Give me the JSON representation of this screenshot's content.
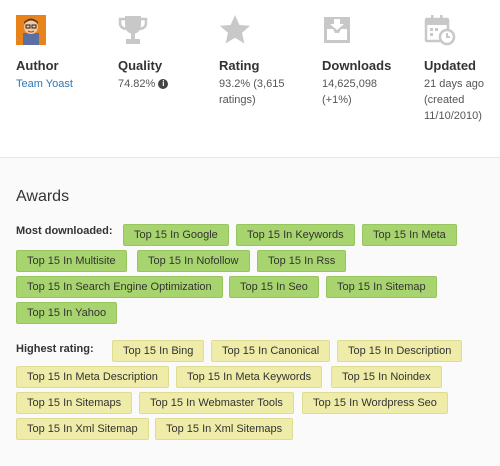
{
  "stats": {
    "author": {
      "label": "Author",
      "value": "Team Yoast"
    },
    "quality": {
      "label": "Quality",
      "value": "74.82%"
    },
    "rating": {
      "label": "Rating",
      "value_line1": "93.2% (3,615",
      "value_line2": "ratings)"
    },
    "downloads": {
      "label": "Downloads",
      "value_line1": "14,625,098",
      "value_line2": "(+1%)"
    },
    "updated": {
      "label": "Updated",
      "value_line1": "21 days ago",
      "value_line2": "(created",
      "value_line3": "11/10/2010)"
    }
  },
  "awards": {
    "title": "Awards",
    "most_downloaded_label": "Most downloaded:",
    "most_downloaded": [
      "Top 15 In Google",
      "Top 15 In Keywords",
      "Top 15 In Meta",
      "Top 15 In Multisite",
      "Top 15 In Nofollow",
      "Top 15 In Rss",
      "Top 15 In Search Engine Optimization",
      "Top 15 In Seo",
      "Top 15 In Sitemap",
      "Top 15 In Yahoo"
    ],
    "highest_rating_label": "Highest rating:",
    "highest_rating": [
      "Top 15 In Bing",
      "Top 15 In Canonical",
      "Top 15 In Description",
      "Top 15 In Meta Description",
      "Top 15 In Meta Keywords",
      "Top 15 In Noindex",
      "Top 15 In Sitemaps",
      "Top 15 In Webmaster Tools",
      "Top 15 In Wordpress Seo",
      "Top 15 In Xml Sitemap",
      "Top 15 In Xml Sitemaps"
    ]
  },
  "colors": {
    "green_tag": "#a8d46f",
    "yellow_tag": "#eeeca8",
    "link": "#2a78b8",
    "icon": "#c8c8c8"
  }
}
